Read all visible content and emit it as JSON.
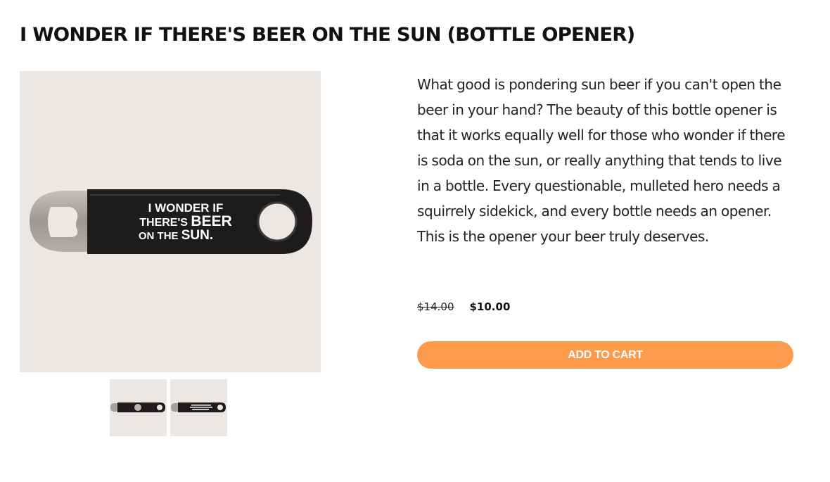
{
  "product": {
    "title": "I WONDER IF THERE'S BEER ON THE SUN (BOTTLE OPENER)",
    "description": "What good is pondering sun beer if you can't open the beer in your hand? The beauty of this bottle opener is that it works equally well for those who wonder if there is soda on the sun, or really anything that tends to live in a bottle. Every questionable, mulleted hero needs a squirrely sidekick, and every bottle needs an opener. This is the opener your beer truly deserves.",
    "price_original": "$14.00",
    "price_sale": "$10.00",
    "add_to_cart_label": "ADD TO CART"
  },
  "image": {
    "opener_text_line1": "I WONDER IF",
    "opener_text_line2a": "THERE'S ",
    "opener_text_line2b": "BEER",
    "opener_text_line3a": "ON THE ",
    "opener_text_line3b": "SUN."
  },
  "thumbnails": [
    {
      "name": "opener-back-thumbnail",
      "text": ""
    },
    {
      "name": "opener-front-thumbnail",
      "text": "I WONDER IF THERE'S BEER ON THE SUN."
    }
  ],
  "colors": {
    "accent": "#fd9a4c",
    "image_background": "#ece7e2",
    "opener_body": "#1d1b1b",
    "opener_metal": "#a5a19d"
  }
}
